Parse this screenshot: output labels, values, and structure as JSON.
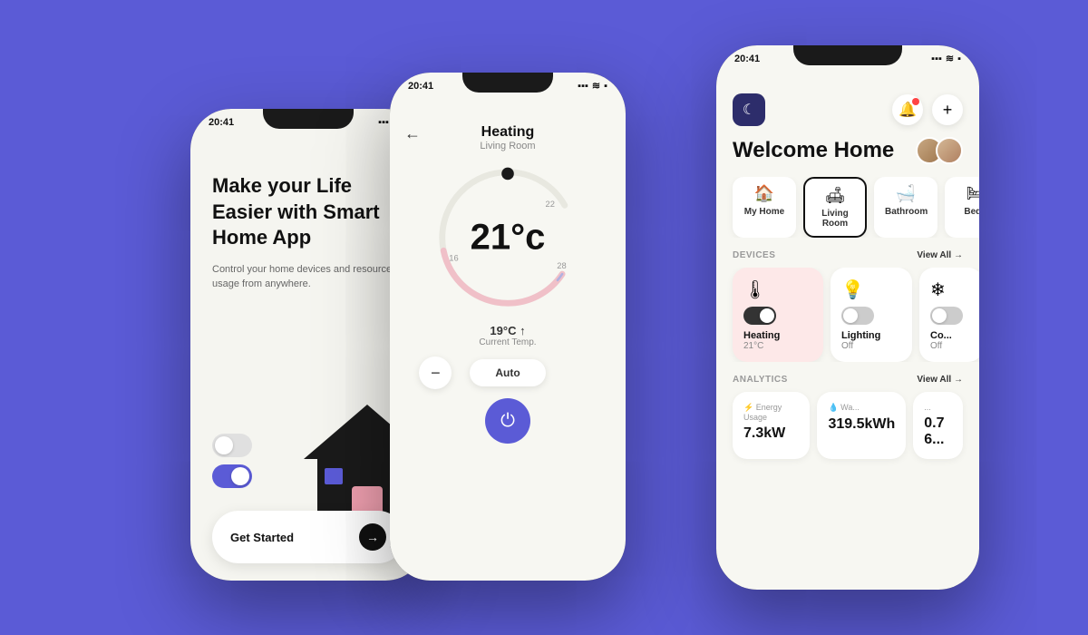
{
  "background": "#5B5BD6",
  "phone1": {
    "status_time": "20:41",
    "title": "Make your Life Easier with Smart Home App",
    "subtitle": "Control your home devices and resources usage from anywhere.",
    "cta_label": "Get Started",
    "toggle1_on": false,
    "toggle2_on": true
  },
  "phone2": {
    "status_time": "20:41",
    "screen_title": "Heating",
    "screen_room": "Living Room",
    "temp_current_label": "21°c",
    "temp_current_note": "19°C ↑",
    "temp_current_sub": "Current Temp.",
    "dial_min": "16",
    "dial_mid": "22",
    "dial_max": "28",
    "auto_label": "Auto",
    "mode_labels": [
      "16",
      "22",
      "28"
    ]
  },
  "phone3": {
    "status_time": "20:41",
    "welcome_title": "Welcome Home",
    "tabs": [
      {
        "label": "My Home",
        "icon": "🏠",
        "active": false
      },
      {
        "label": "Living Room",
        "icon": "🛋",
        "active": true
      },
      {
        "label": "Bathroom",
        "icon": "🛁",
        "active": false
      },
      {
        "label": "Bed...",
        "icon": "🛏",
        "active": false
      }
    ],
    "devices_section": "DEVICES",
    "view_all_label": "View All →",
    "devices": [
      {
        "name": "Heating",
        "status": "21°C",
        "icon": "🌡",
        "active": true,
        "card_type": "heating"
      },
      {
        "name": "Lighting",
        "status": "Off",
        "icon": "💡",
        "active": false,
        "card_type": "normal"
      },
      {
        "name": "Co...",
        "status": "Off",
        "icon": "❄",
        "active": false,
        "card_type": "normal"
      }
    ],
    "analytics_section": "ANALYTICS",
    "analytics_view_all": "View All →",
    "analytics": [
      {
        "label": "⚡ Energy Usage",
        "value": "7.3kW"
      },
      {
        "label": "💧 Wa...",
        "value": "319.5kWh"
      },
      {
        "label": "0.7 6...",
        "value": ""
      }
    ]
  }
}
